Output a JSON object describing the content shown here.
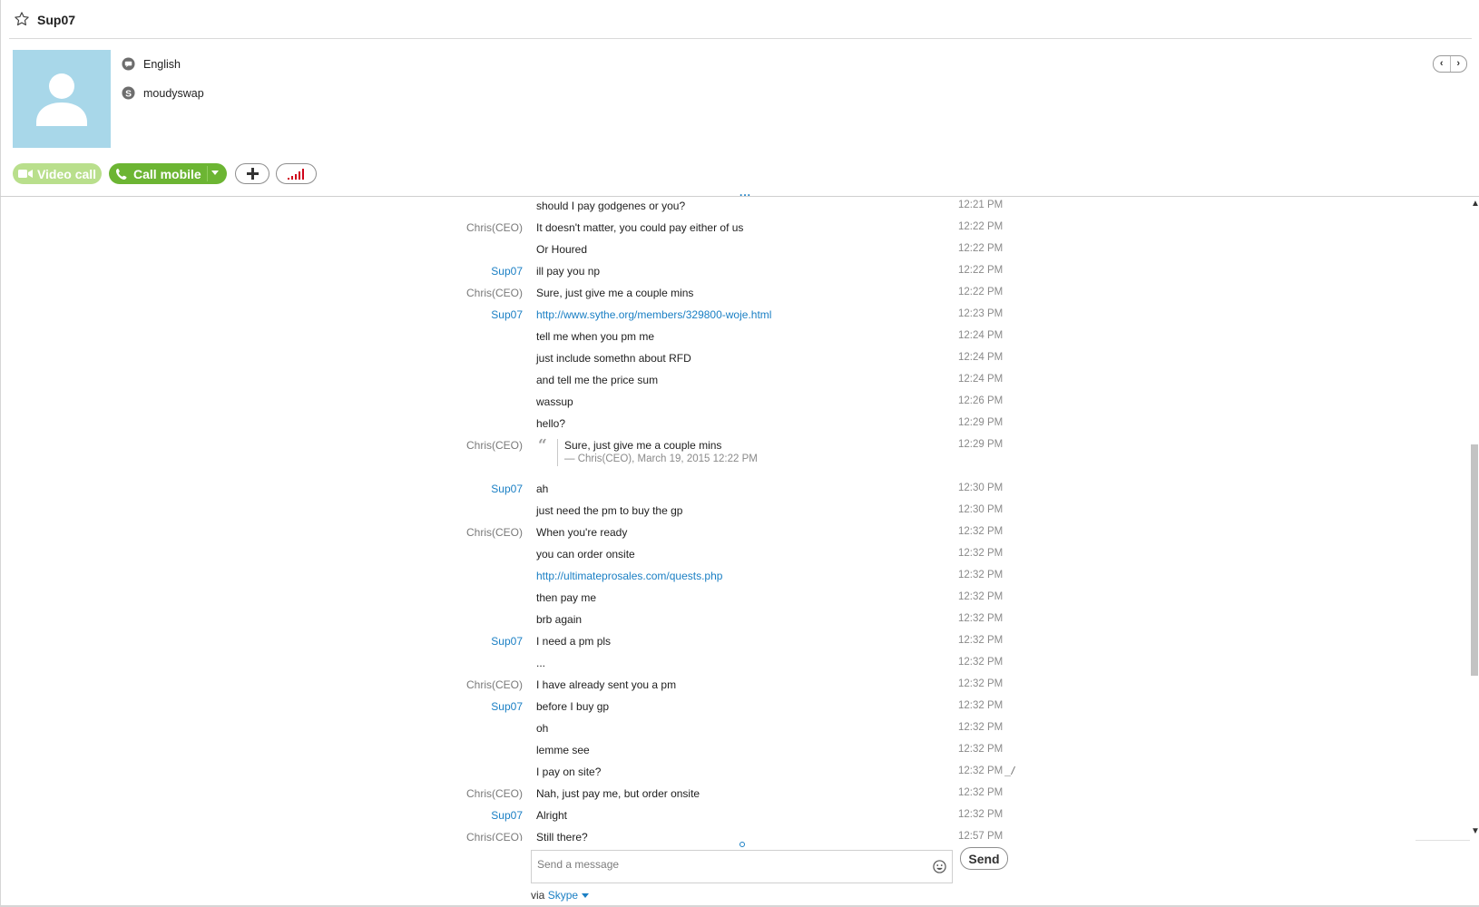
{
  "header": {
    "contact_name": "Sup07",
    "language": "English",
    "skype_name": "moudyswap"
  },
  "actions": {
    "video_call_label": "Video call",
    "call_mobile_label": "Call mobile"
  },
  "messages": [
    {
      "sender": "",
      "text": "should I pay godgenes or you?",
      "time": "12:21 PM"
    },
    {
      "sender": "Chris(CEO)",
      "text": "It doesn't matter, you could pay either of us",
      "time": "12:22 PM"
    },
    {
      "sender": "",
      "text": "Or Houred",
      "time": "12:22 PM"
    },
    {
      "sender": "Sup07",
      "text": "ill pay you np",
      "time": "12:22 PM"
    },
    {
      "sender": "Chris(CEO)",
      "text": "Sure, just give me a couple mins",
      "time": "12:22 PM"
    },
    {
      "sender": "Sup07",
      "text": "http://www.sythe.org/members/329800-woje.html",
      "time": "12:23 PM"
    },
    {
      "sender": "",
      "text": "tell me when you pm me",
      "time": "12:24 PM"
    },
    {
      "sender": "",
      "text": "just include somethn about RFD",
      "time": "12:24 PM"
    },
    {
      "sender": "",
      "text": "and tell me the price sum",
      "time": "12:24 PM"
    },
    {
      "sender": "",
      "text": "wassup",
      "time": "12:26 PM"
    },
    {
      "sender": "",
      "text": "hello?",
      "time": "12:29 PM"
    },
    {
      "sender": "Chris(CEO)",
      "quote_text": "Sure, just give me a couple mins",
      "quote_cite": "— Chris(CEO), March 19, 2015 12:22 PM",
      "time": "12:29 PM"
    },
    {
      "sender": "Sup07",
      "text": "ah",
      "time": "12:30 PM"
    },
    {
      "sender": "",
      "text": "just need the pm to buy the gp",
      "time": "12:30 PM"
    },
    {
      "sender": "Chris(CEO)",
      "text": "When you're ready",
      "time": "12:32 PM"
    },
    {
      "sender": "",
      "text": "you can order onsite",
      "time": "12:32 PM"
    },
    {
      "sender": "",
      "text": "http://ultimateprosales.com/quests.php",
      "time": "12:32 PM"
    },
    {
      "sender": "",
      "text": "then pay me",
      "time": "12:32 PM"
    },
    {
      "sender": "",
      "text": "brb again",
      "time": "12:32 PM"
    },
    {
      "sender": "Sup07",
      "text": "I need a pm pls",
      "time": "12:32 PM"
    },
    {
      "sender": "",
      "text": "...",
      "time": "12:32 PM"
    },
    {
      "sender": "Chris(CEO)",
      "text": "I have already sent you a pm",
      "time": "12:32 PM"
    },
    {
      "sender": "Sup07",
      "text": "before I buy gp",
      "time": "12:32 PM"
    },
    {
      "sender": "",
      "text": "oh",
      "time": "12:32 PM"
    },
    {
      "sender": "",
      "text": "lemme see",
      "time": "12:32 PM"
    },
    {
      "sender": "",
      "text": "I pay on site?",
      "time": "12:32 PM"
    },
    {
      "sender": "Chris(CEO)",
      "text": "Nah, just pay me, but order onsite",
      "time": "12:32 PM"
    },
    {
      "sender": "Sup07",
      "text": "Alright",
      "time": "12:32 PM"
    },
    {
      "sender": "Chris(CEO)",
      "text": "Still there?",
      "time": "12:57 PM"
    }
  ],
  "composer": {
    "placeholder": "Send a message",
    "send_label": "Send",
    "via_prefix": "via",
    "service": "Skype"
  },
  "colors": {
    "accent_blue": "#1a7fc4",
    "call_green": "#6cb533",
    "video_green_disabled": "#b9df8c",
    "avatar_bg": "#a8d7e9"
  }
}
